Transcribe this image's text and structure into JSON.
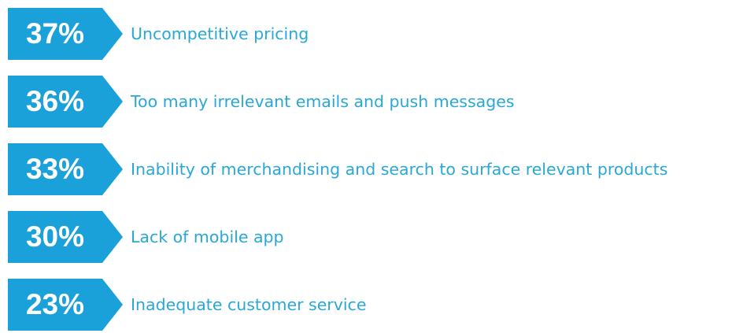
{
  "chart_data": {
    "type": "bar",
    "categories": [
      "Uncompetitive pricing",
      "Too many irrelevant emails and push messages",
      "Inability of merchandising and search to surface relevant products",
      "Lack of mobile app",
      "Inadequate customer service"
    ],
    "values": [
      37,
      36,
      33,
      30,
      23
    ],
    "value_labels": [
      "37%",
      "36%",
      "33%",
      "30%",
      "23%"
    ],
    "unit": "%",
    "colors": {
      "badge": "#1ba1d9",
      "label": "#29a8d6",
      "value_text": "#ffffff"
    }
  }
}
